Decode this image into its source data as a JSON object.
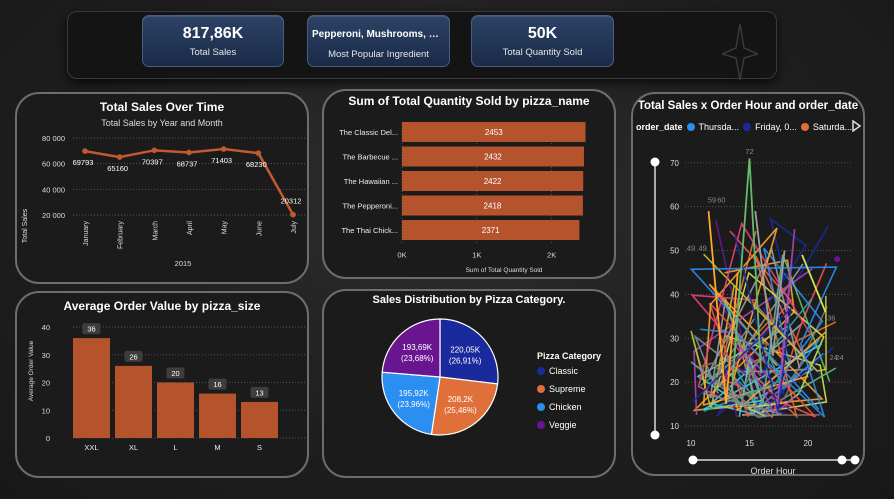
{
  "kpis": {
    "total_sales": {
      "value": "817,86K",
      "label": "Total Sales"
    },
    "popular_ingredient": {
      "value": "Pepperoni, Mushrooms, Red...",
      "label": "Most Popular Ingredient"
    },
    "total_quantity": {
      "value": "50K",
      "label": "Total Quantity Sold"
    }
  },
  "chart_data": [
    {
      "type": "line",
      "title": "Total Sales Over Time",
      "subtitle": "Total Sales by Year and Month",
      "ylabel": "Total Sales",
      "year": "2015",
      "categories": [
        "January",
        "February",
        "March",
        "April",
        "May",
        "June",
        "July"
      ],
      "values": [
        69793,
        65160,
        70397,
        68737,
        71403,
        68230,
        20312
      ],
      "ylim": [
        20000,
        80000
      ],
      "yticks": [
        "20 000",
        "40 000",
        "60 000",
        "80 000"
      ],
      "color": "#c25a30",
      "grid": true
    },
    {
      "type": "bar",
      "orientation": "horizontal",
      "title": "Sum of Total Quantity Sold by pizza_name",
      "xlabel": "Sum of Total Quantity Sold",
      "categories": [
        "The Classic Del...",
        "The Barbecue ...",
        "The Hawaiian ...",
        "The Pepperoni...",
        "The Thai Chick..."
      ],
      "values": [
        2453,
        2432,
        2422,
        2418,
        2371
      ],
      "xticks": [
        "0K",
        "1K",
        "2K"
      ],
      "xlim": [
        0,
        2700
      ],
      "color": "#b5532d"
    },
    {
      "type": "bar",
      "title": "Average Order Value by pizza_size",
      "ylabel": "Average Order Value",
      "categories": [
        "XXL",
        "XL",
        "L",
        "M",
        "S"
      ],
      "values": [
        36,
        26,
        20,
        16,
        13
      ],
      "ylim": [
        0,
        40
      ],
      "yticks": [
        "0",
        "10",
        "20",
        "30",
        "40"
      ],
      "color": "#b5532d"
    },
    {
      "type": "pie",
      "title": "Sales Distribution by Pizza Category.",
      "legend_title": "Pizza Category",
      "slices": [
        {
          "name": "Classic",
          "value": 220.05,
          "label": "220,05K",
          "pct": "(26,91%)",
          "color": "#1a2a9c"
        },
        {
          "name": "Supreme",
          "value": 208.2,
          "label": "208,2K",
          "pct": "(25,46%)",
          "color": "#e0703a"
        },
        {
          "name": "Chicken",
          "value": 195.92,
          "label": "195,92K",
          "pct": "(23,96%)",
          "color": "#2a8ff0"
        },
        {
          "name": "Veggie",
          "value": 193.69,
          "label": "193,69K",
          "pct": "(23,68%)",
          "color": "#6a1590"
        }
      ]
    },
    {
      "type": "line",
      "title": "Total Sales x Order Hour and order_date",
      "legend_title": "order_date",
      "legend": [
        {
          "name": "Thursda...",
          "color": "#2a8ff0"
        },
        {
          "name": "Friday, 0...",
          "color": "#1a2a9c"
        },
        {
          "name": "Saturda...",
          "color": "#e0703a"
        }
      ],
      "xlabel": "Order Hour",
      "xticks": [
        "10",
        "15",
        "20"
      ],
      "yticks": [
        "10",
        "20",
        "30",
        "40",
        "50",
        "60",
        "70"
      ],
      "xlim": [
        10,
        23
      ],
      "ylim": [
        10,
        72
      ],
      "point_labels": [
        {
          "x": 15,
          "y": 72,
          "text": "72"
        },
        {
          "x": 11.8,
          "y": 61,
          "text": "59"
        },
        {
          "x": 12.6,
          "y": 61,
          "text": "60"
        },
        {
          "x": 10,
          "y": 50,
          "text": "49"
        },
        {
          "x": 11,
          "y": 50,
          "text": "49"
        },
        {
          "x": 22,
          "y": 34,
          "text": "36"
        },
        {
          "x": 22.2,
          "y": 25,
          "text": "24"
        },
        {
          "x": 22.7,
          "y": 25,
          "text": "24"
        }
      ]
    }
  ]
}
